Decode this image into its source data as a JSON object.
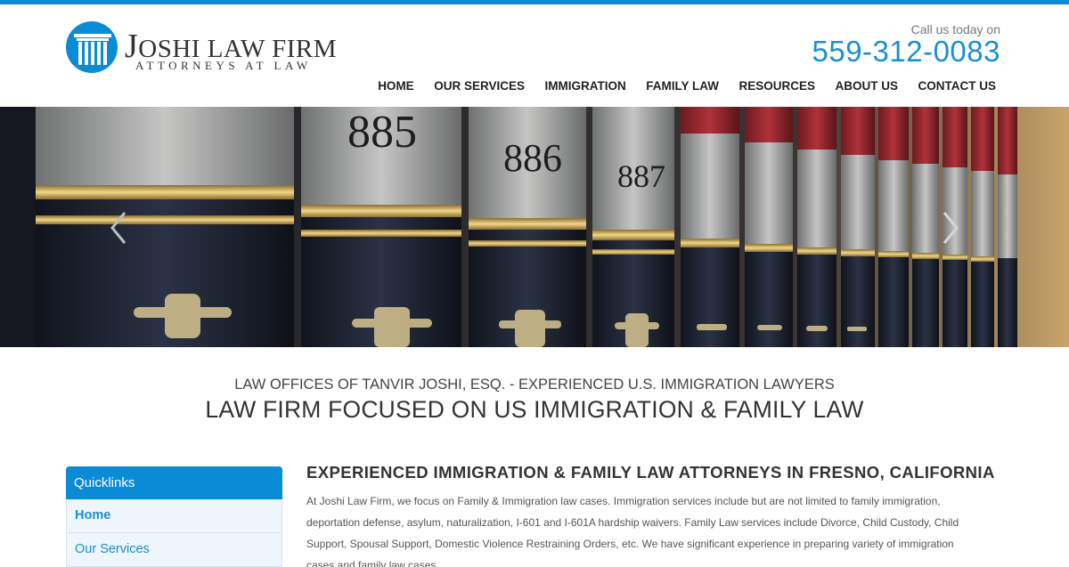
{
  "header": {
    "logo_main_first": "J",
    "logo_main_rest": "OSHI LAW FIRM",
    "logo_sub": "ATTORNEYS AT LAW",
    "call_label": "Call us today on",
    "phone": "559-312-0083"
  },
  "nav": {
    "items": [
      {
        "label": "HOME"
      },
      {
        "label": "OUR SERVICES"
      },
      {
        "label": "IMMIGRATION"
      },
      {
        "label": "FAMILY LAW"
      },
      {
        "label": "RESOURCES"
      },
      {
        "label": "ABOUT US"
      },
      {
        "label": "CONTACT US"
      }
    ]
  },
  "hero": {
    "spine_numbers": [
      "885",
      "886",
      "887"
    ]
  },
  "intro": {
    "tagline": "LAW OFFICES OF TANVIR JOSHI, ESQ. - EXPERIENCED U.S. IMMIGRATION LAWYERS",
    "title": "LAW FIRM FOCUSED ON US IMMIGRATION & FAMILY LAW"
  },
  "sidebar": {
    "heading": "Quicklinks",
    "items": [
      {
        "label": "Home"
      },
      {
        "label": "Our Services"
      }
    ]
  },
  "content": {
    "heading": "EXPERIENCED IMMIGRATION & FAMILY LAW ATTORNEYS IN FRESNO, CALIFORNIA",
    "body": "At Joshi Law Firm, we focus on Family & Immigration law cases. Immigration services include but are not limited to family immigration, deportation defense, asylum, naturalization, I-601 and I-601A hardship waivers. Family Law services include Divorce, Child Custody, Child Support, Spousal Support, Domestic Violence Restraining Orders, etc. We have  significant experience in preparing variety of immigration cases and family law cases."
  },
  "colors": {
    "brand_blue": "#0a8bd6",
    "phone_blue": "#1a8fd2",
    "sidebar_bg": "#eef5fb"
  }
}
